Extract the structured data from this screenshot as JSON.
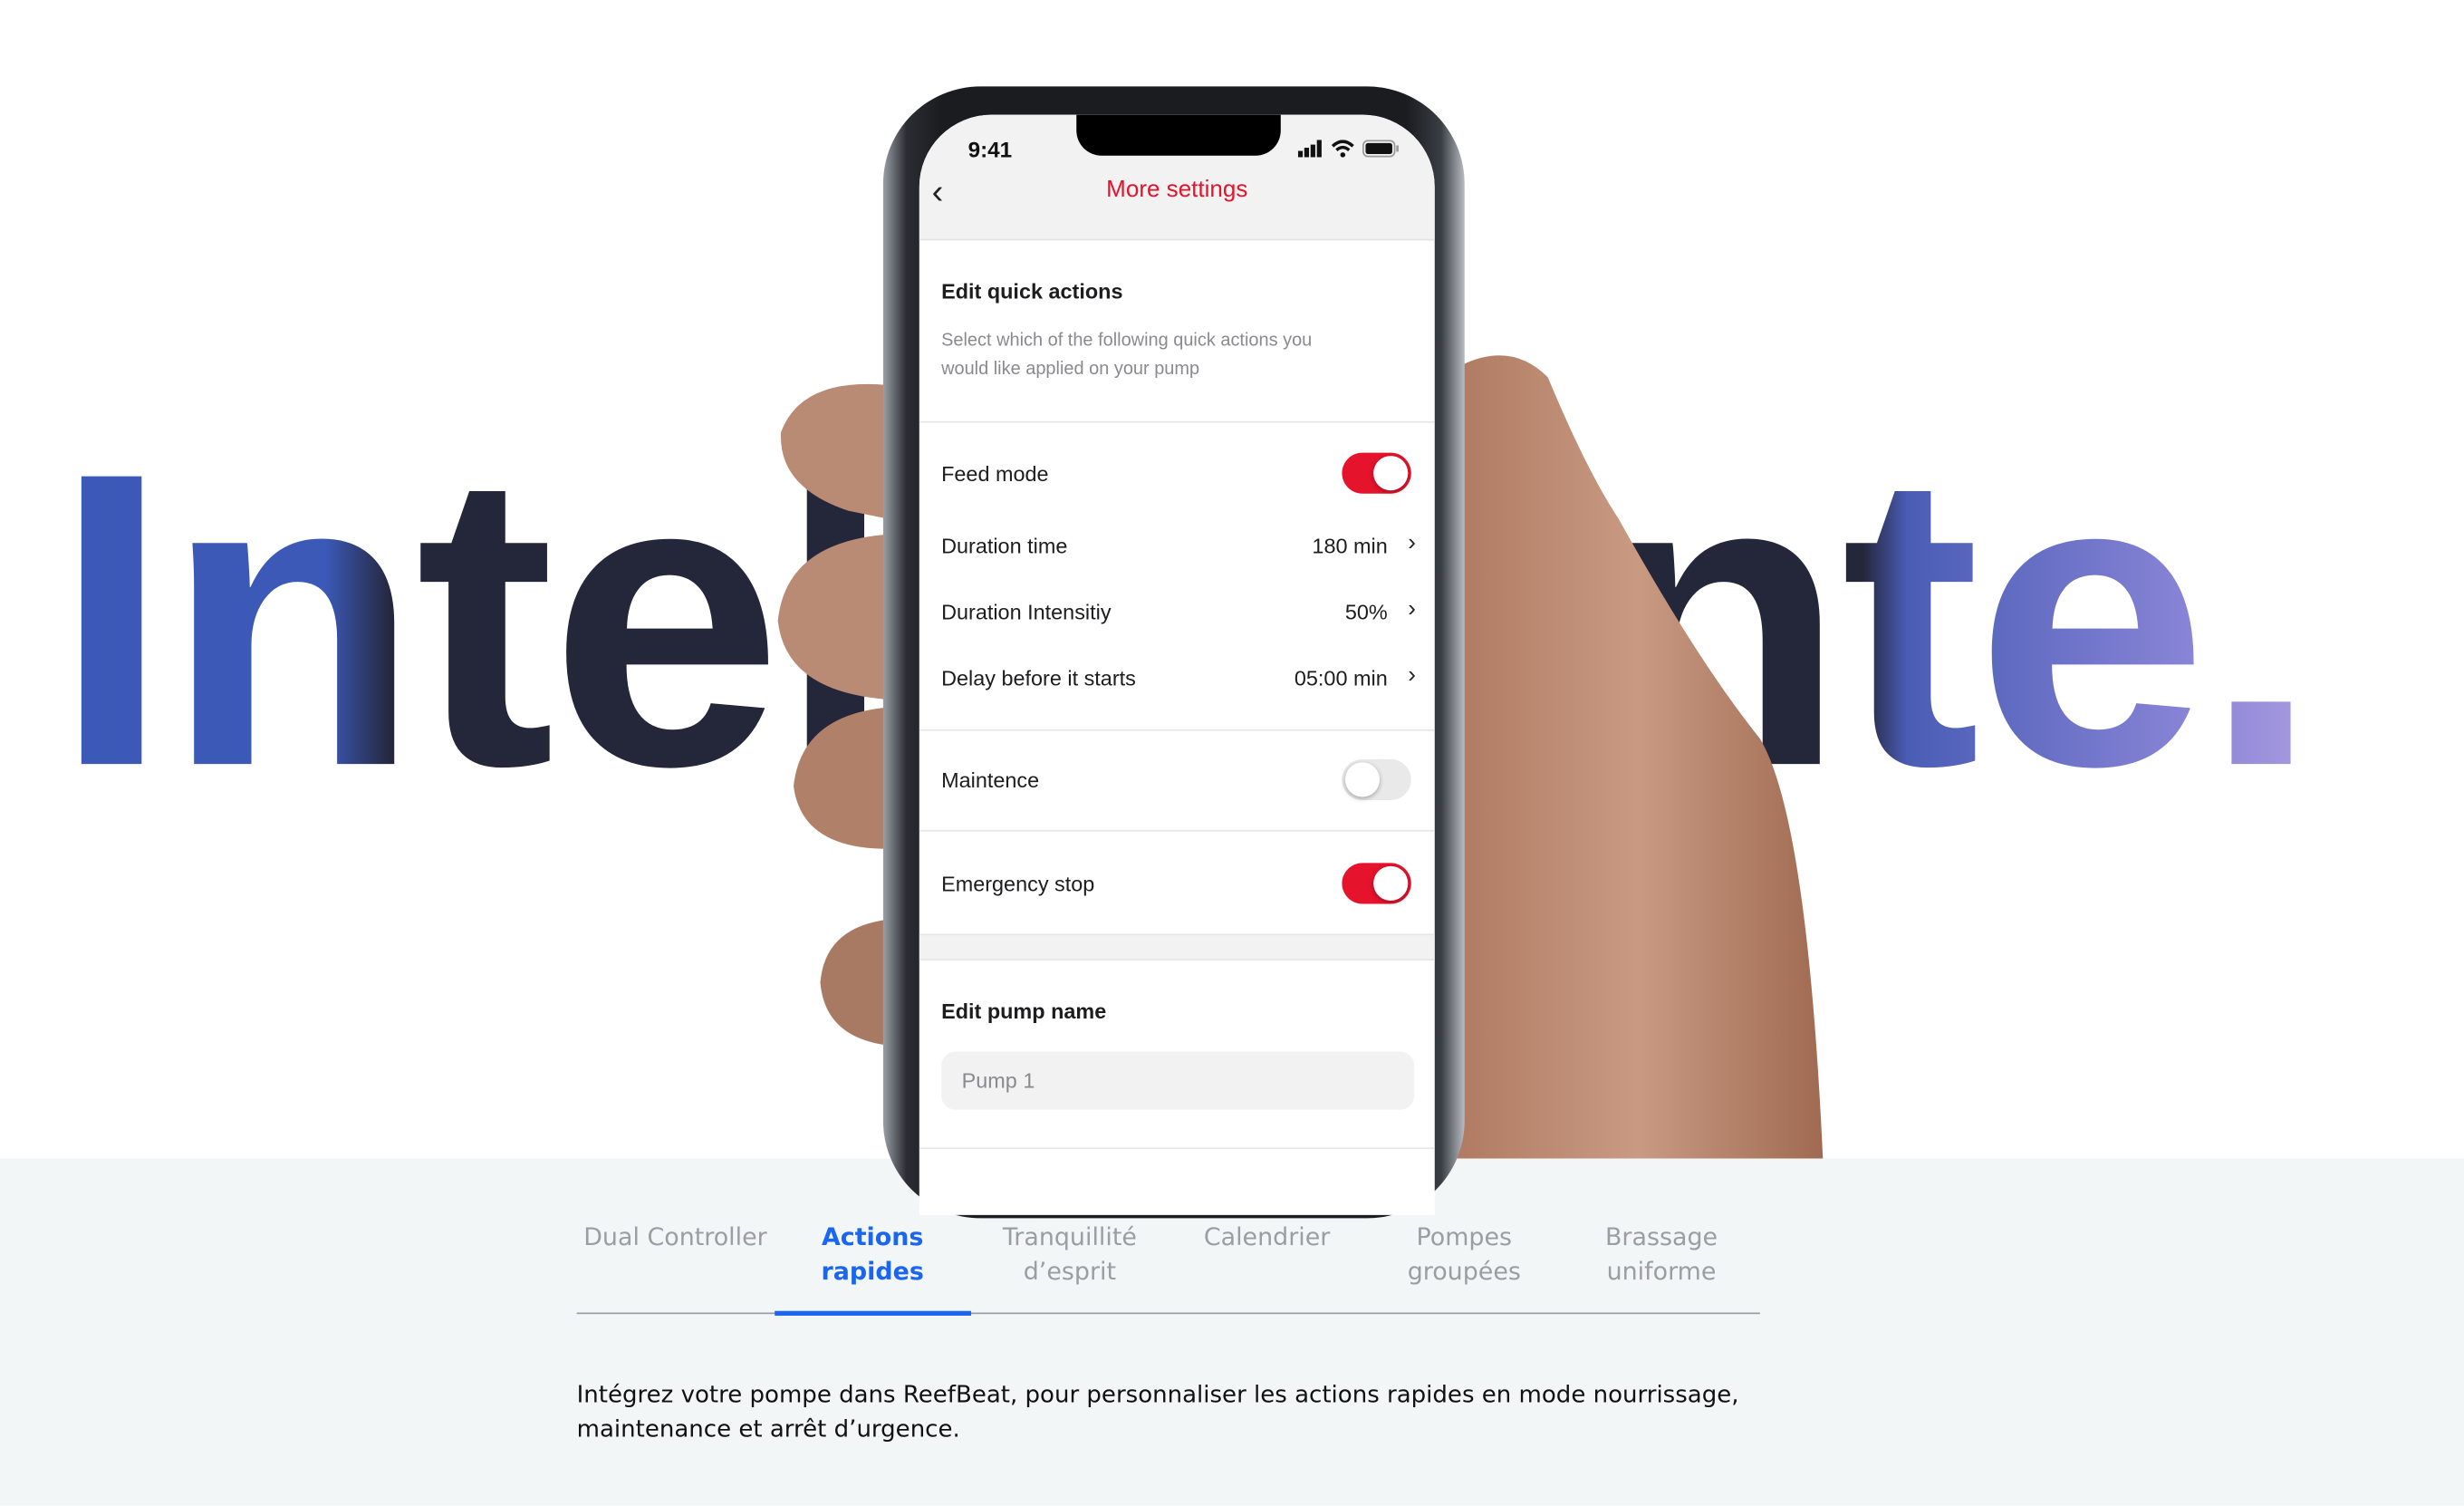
{
  "hero": {
    "word": "Intelligente."
  },
  "colors": {
    "accent_red": "#e5132b",
    "tab_active": "#1a66f0",
    "headline": "#24263a"
  },
  "phone": {
    "status_time": "9:41",
    "status_icons": [
      "signal-icon",
      "wifi-icon",
      "battery-icon"
    ],
    "header": {
      "back_icon": "chevron-left-icon",
      "title": "More settings"
    },
    "quick_actions": {
      "title": "Edit quick actions",
      "description": "Select which of the following quick actions you would like applied on your pump",
      "feed_mode": {
        "label": "Feed mode",
        "enabled": true
      },
      "rows": [
        {
          "label": "Duration time",
          "value": "180 min"
        },
        {
          "label": "Duration Intensitiy",
          "value": "50%"
        },
        {
          "label": "Delay before it starts",
          "value": "05:00 min"
        }
      ],
      "maintenance": {
        "label": "Maintence",
        "enabled": false
      },
      "emergency": {
        "label": "Emergency stop",
        "enabled": true
      }
    },
    "pump_name": {
      "title": "Edit pump name",
      "value": "Pump 1"
    }
  },
  "tabs": [
    {
      "label": "Dual Controller",
      "active": false
    },
    {
      "label": "Actions rapides",
      "active": true
    },
    {
      "label": "Tranquillité d’esprit",
      "active": false
    },
    {
      "label": "Calendrier",
      "active": false
    },
    {
      "label": "Pompes groupées",
      "active": false
    },
    {
      "label": "Brassage uniforme",
      "active": false
    }
  ],
  "description": "Intégrez votre pompe dans ReefBeat, pour personnaliser les actions rapides en mode nourrissage, maintenance et arrêt d’urgence."
}
